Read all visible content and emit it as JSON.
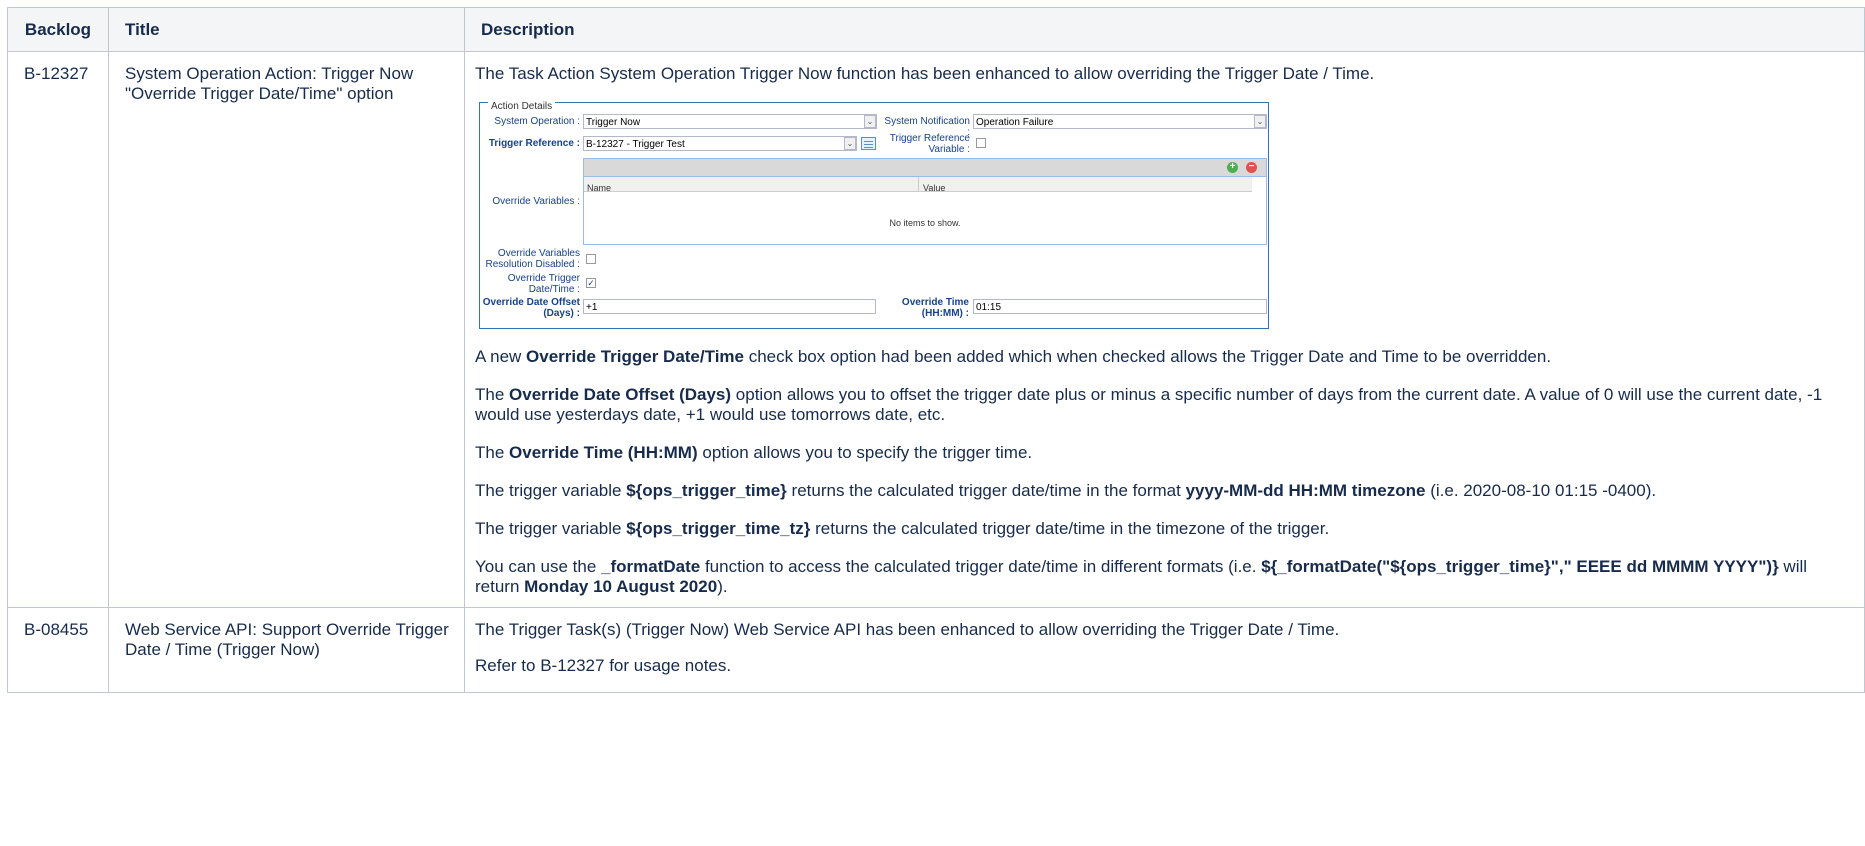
{
  "headers": {
    "backlog": "Backlog",
    "title": "Title",
    "description": "Description"
  },
  "rows": [
    {
      "backlog": "B-12327",
      "title": "System Operation Action: Trigger Now \"Override Trigger Date/Time\" option",
      "intro": "The Task Action System Operation Trigger Now function has been enhanced to allow overriding the Trigger Date / Time.",
      "form": {
        "legend": "Action Details",
        "system_operation_label": "System Operation :",
        "system_operation_value": "Trigger Now",
        "system_notification_label": "System Notification :",
        "system_notification_value": "Operation Failure",
        "trigger_reference_label": "Trigger Reference :",
        "trigger_reference_value": "B-12327 - Trigger Test",
        "trigger_reference_variable_label_1": "Trigger Reference",
        "trigger_reference_variable_label_2": "Variable :",
        "override_variables_label": "Override Variables :",
        "grid_col_name": "Name",
        "grid_col_value": "Value",
        "grid_empty": "No items to show.",
        "ovr_resolution_label_1": "Override Variables",
        "ovr_resolution_label_2": "Resolution Disabled :",
        "override_trigger_label_1": "Override Trigger",
        "override_trigger_label_2": "Date/Time :",
        "override_trigger_checked": "✓",
        "offset_label_1": "Override Date Offset",
        "offset_label_2": "(Days) :",
        "offset_value": "+1",
        "time_label_1": "Override Time",
        "time_label_2": "(HH:MM) :",
        "time_value": "01:15"
      },
      "p1": {
        "a": "A new ",
        "b": "Override Trigger Date/Time",
        "c": " check box option had been added which when checked allows the Trigger Date and Time to be overridden."
      },
      "p2": {
        "a": "The ",
        "b": "Override Date Offset (Days)",
        "c": " option allows you to offset the trigger date plus or minus a specific number of days from the current date. A value of 0 will use the current date, -1 would use yesterdays date, +1 would use tomorrows date, etc."
      },
      "p3": {
        "a": "The ",
        "b": "Override Time (HH:MM)",
        "c": " option allows you to specify the trigger time."
      },
      "p4": {
        "a": "The trigger variable ",
        "b": "${ops_trigger_time}",
        "c": " returns the calculated trigger date/time in the format ",
        "d": "yyyy-MM-dd HH:MM timezone",
        "e": " (i.e. 2020-08-10 01:15 -0400)."
      },
      "p5": {
        "a": "The trigger variable ",
        "b": "${ops_trigger_time_tz}",
        "c": " returns the calculated trigger date/time in the timezone of the trigger."
      },
      "p6": {
        "a": "You can use the ",
        "b": "_formatDate",
        "c": " function to access the calculated trigger date/time in different formats (i.e. ",
        "d": "${_formatDate(\"${ops_trigger_time}\",\" EEEE dd MMMM YYYY\")}",
        "e": " will return ",
        "f": "Monday 10 August 2020",
        "g": ")."
      }
    },
    {
      "backlog": "B-08455",
      "title": "Web Service API: Support Override Trigger Date / Time (Trigger Now)",
      "p1": "The Trigger Task(s) (Trigger Now) Web Service API has been enhanced to allow overriding the Trigger Date / Time.",
      "p2": "Refer to B-12327 for usage notes."
    }
  ],
  "colors": {
    "header_bg": "#f4f5f7",
    "border": "#c1c7d0",
    "form_border": "#2e75b6",
    "form_label": "#15428b"
  }
}
